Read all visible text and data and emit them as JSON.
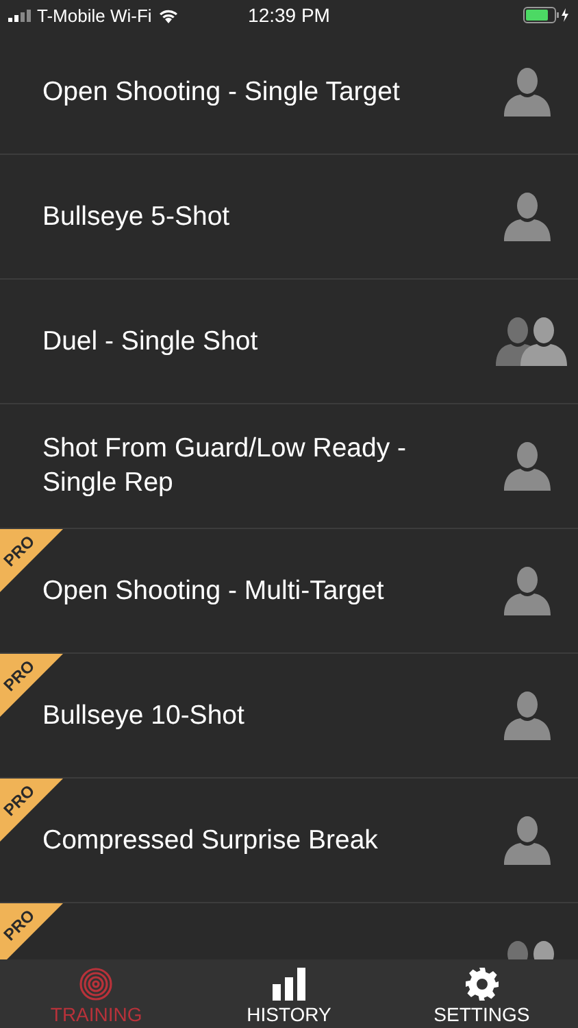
{
  "status_bar": {
    "carrier": "T-Mobile Wi-Fi",
    "time": "12:39 PM"
  },
  "drills": [
    {
      "title": "Open Shooting - Single Target",
      "pro": false,
      "kind": "solo"
    },
    {
      "title": "Bullseye 5-Shot",
      "pro": false,
      "kind": "solo"
    },
    {
      "title": "Duel - Single Shot",
      "pro": false,
      "kind": "duo"
    },
    {
      "title": "Shot From Guard/Low Ready - Single Rep",
      "pro": false,
      "kind": "solo"
    },
    {
      "title": "Open Shooting - Multi-Target",
      "pro": true,
      "badge": "PRO",
      "kind": "solo"
    },
    {
      "title": "Bullseye 10-Shot",
      "pro": true,
      "badge": "PRO",
      "kind": "solo"
    },
    {
      "title": "Compressed Surprise Break",
      "pro": true,
      "badge": "PRO",
      "kind": "solo"
    },
    {
      "pro": true,
      "badge": "PRO",
      "kind": "duo"
    }
  ],
  "tabs": [
    {
      "label": "TRAINING",
      "kind": "target",
      "selected": true
    },
    {
      "label": "HISTORY",
      "kind": "bars",
      "selected": false
    },
    {
      "label": "SETTINGS",
      "kind": "gear",
      "selected": false
    }
  ]
}
